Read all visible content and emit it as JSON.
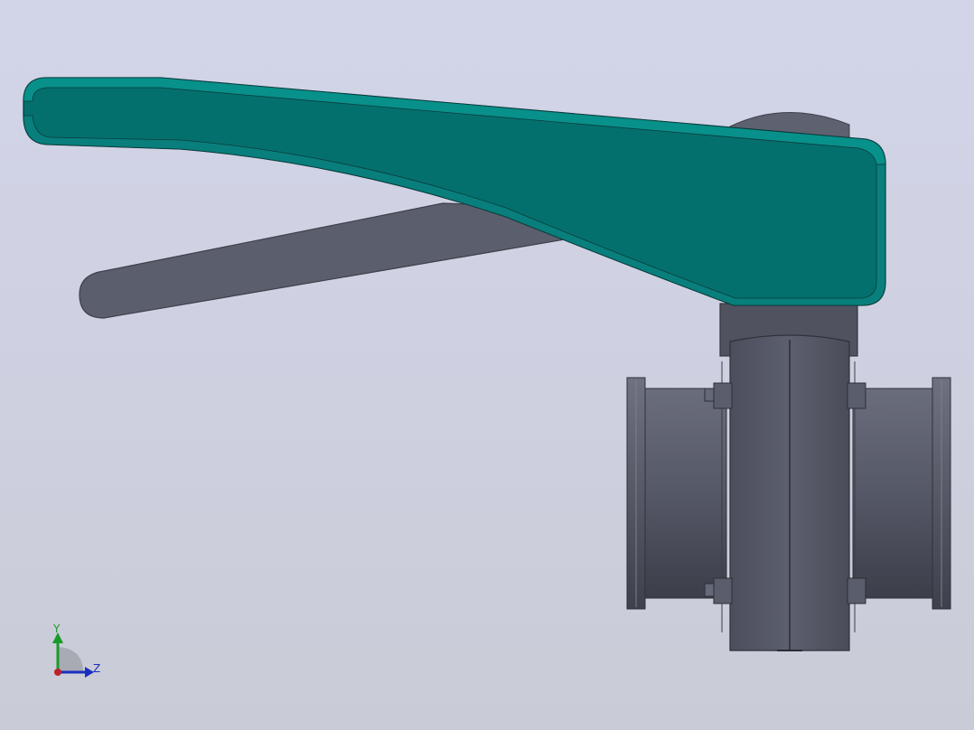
{
  "viewport": {
    "background_top": "#d2d4e8",
    "background_bottom": "#c9cbd6"
  },
  "model": {
    "handle_color": "#04706e",
    "handle_edge_color": "#08908b",
    "body_color": "#5a5d6b",
    "body_dark_color": "#424451"
  },
  "triad": {
    "y_label": "Y",
    "z_label": "Z",
    "y_color": "#1a9a2a",
    "z_color": "#1a2fbf",
    "x_color": "#c0202a"
  }
}
